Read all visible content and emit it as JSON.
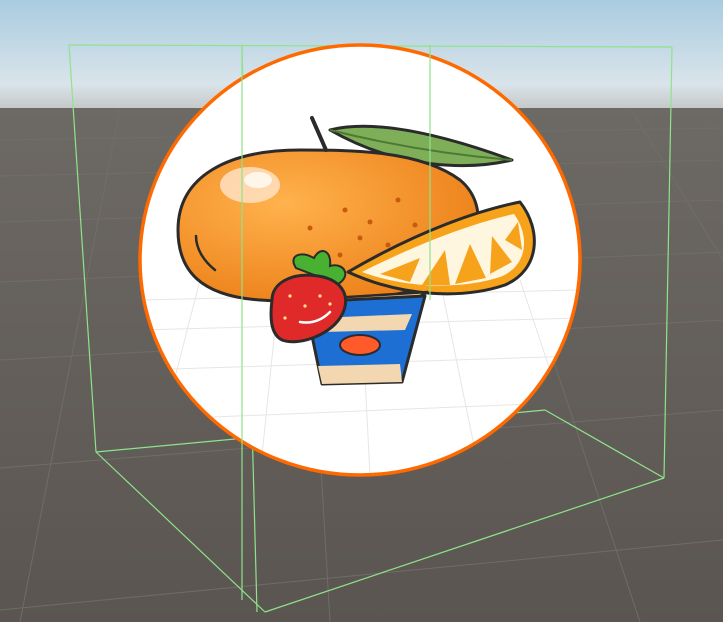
{
  "scene": {
    "sky_color_top": "#a9cbe0",
    "sky_color_horizon": "#d9e4ea",
    "ground_color": "#5e5954",
    "grid_line_color": "#6c6863",
    "bounds_gizmo_color": "#8fe38a",
    "selection_outline_color": "#ff6a00"
  },
  "sprite": {
    "shape": "circle",
    "background_color": "#ffffff",
    "illustration": {
      "subject_icons": [
        "orange-fruit-icon",
        "orange-leaf-icon",
        "orange-slice-icon",
        "strawberry-icon",
        "yogurt-cup-icon"
      ],
      "orange_color": "#f28a1c",
      "slice_color": "#f7a21b",
      "strawberry_color": "#e02a2a",
      "cup_color": "#1d6fd3",
      "cup_label_color": "#ff5a2a"
    }
  }
}
